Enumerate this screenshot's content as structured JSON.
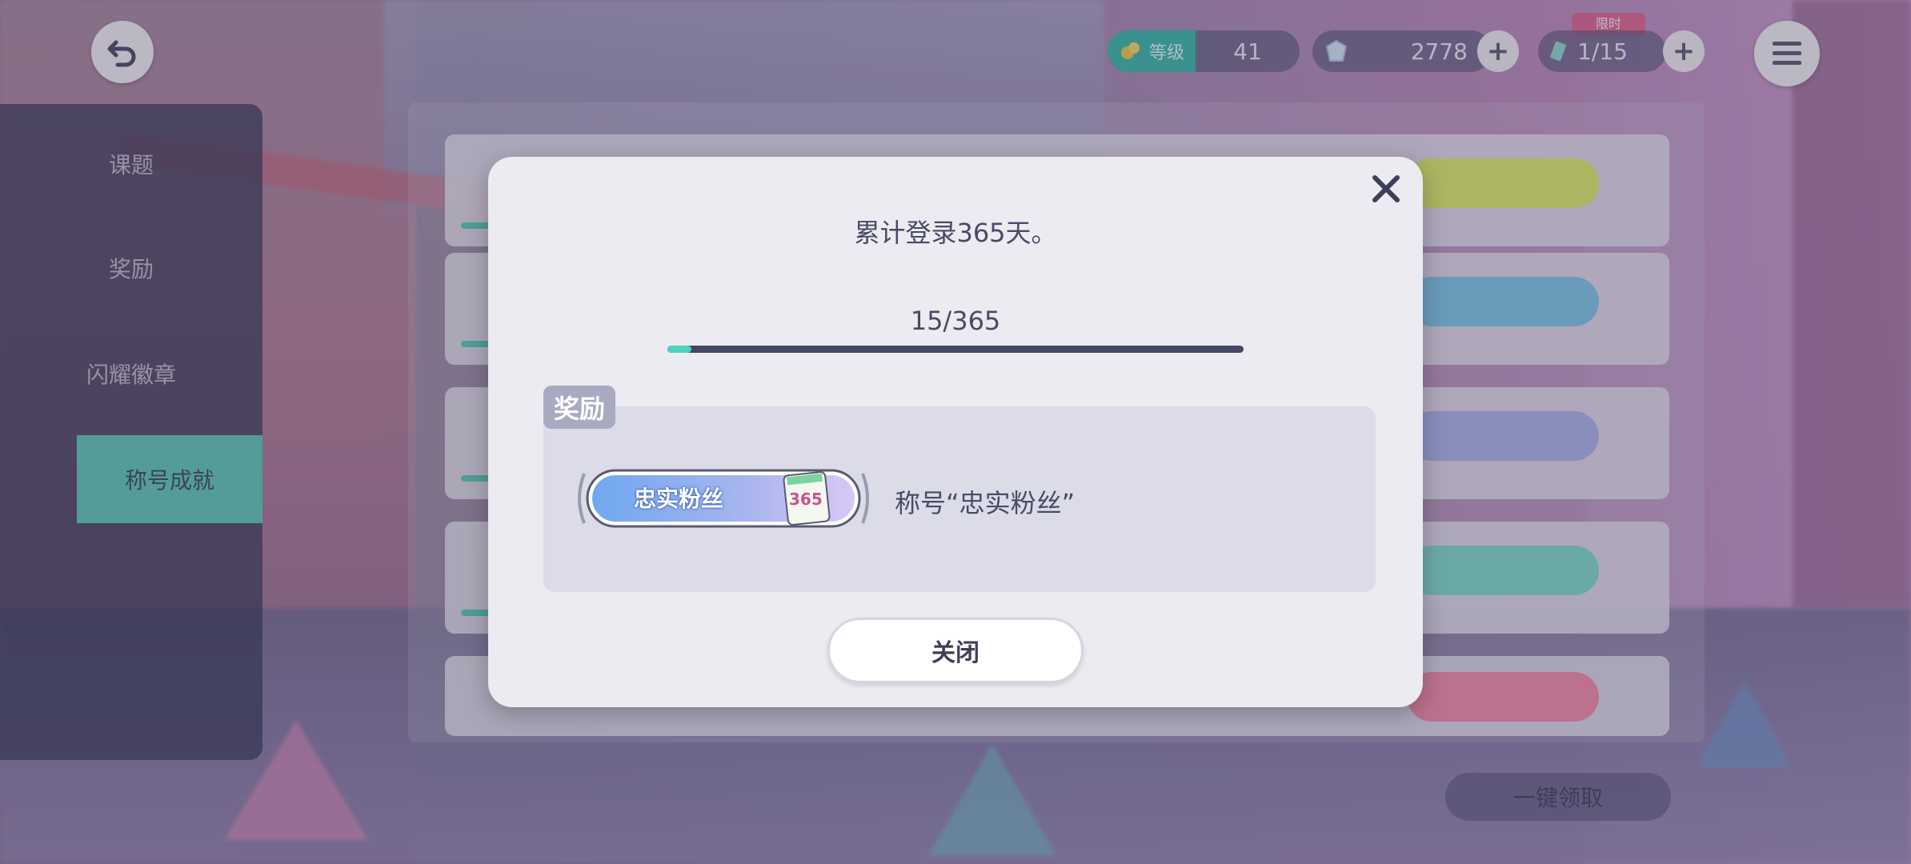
{
  "top_bar": {
    "gold_label": "等级",
    "gold_value": "41",
    "gem_value": "2778",
    "ticket_value": "1/15",
    "limited_tag": "限时"
  },
  "side_menu": {
    "items": [
      {
        "label": "课题"
      },
      {
        "label": "奖励"
      },
      {
        "label": "闪耀徽章"
      },
      {
        "label": "称号成就"
      }
    ]
  },
  "list": {
    "claim_all_label": "一键领取"
  },
  "modal": {
    "title": "累计登录365天。",
    "progress_text": "15/365",
    "progress_current": 15,
    "progress_total": 365,
    "reward_tag": "奖励",
    "badge_text": "忠实粉丝",
    "badge_number": "365",
    "reward_name": "称号“忠实粉丝”",
    "close_label": "关闭"
  },
  "colors": {
    "accent": "#4cd2c0",
    "progress_track": "#454564",
    "modal_bg": "#ebebf1",
    "text": "#4a4a66"
  }
}
